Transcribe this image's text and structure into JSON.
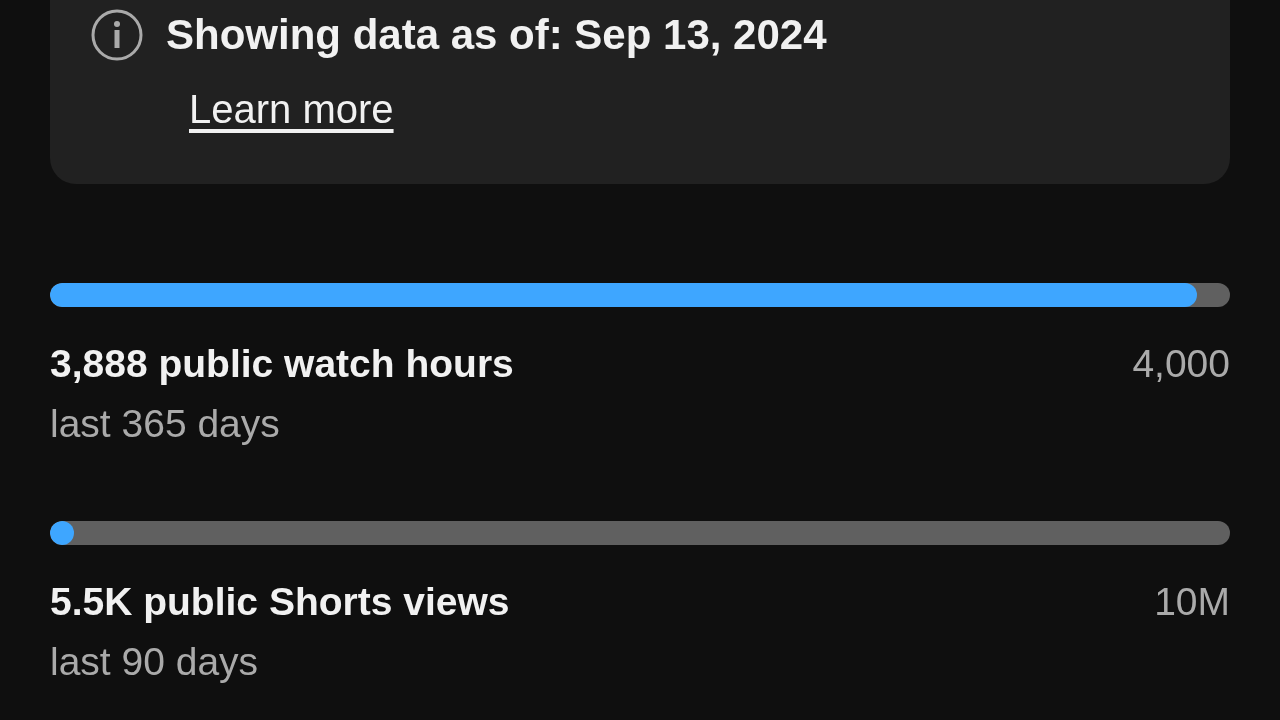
{
  "notice": {
    "title": "Showing data as of: Sep 13, 2024",
    "link": "Learn more"
  },
  "metrics": [
    {
      "label": "3,888 public watch hours",
      "goal": "4,000",
      "period": "last 365 days",
      "level": 0.972
    },
    {
      "label": "5.5K public Shorts views",
      "goal": "10M",
      "period": "last 90 days",
      "level": 0.0006
    }
  ]
}
